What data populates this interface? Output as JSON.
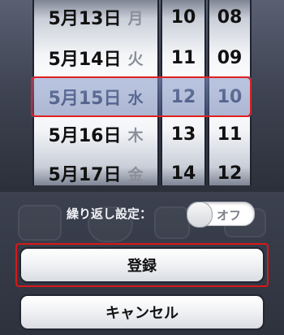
{
  "picker": {
    "dates": [
      {
        "date": "5月13日",
        "weekday": "月"
      },
      {
        "date": "5月14日",
        "weekday": "火"
      },
      {
        "date": "5月15日",
        "weekday": "水"
      },
      {
        "date": "5月16日",
        "weekday": "木"
      },
      {
        "date": "5月17日",
        "weekday": "金"
      }
    ],
    "hours": [
      "10",
      "11",
      "12",
      "13",
      "14"
    ],
    "minutes": [
      "08",
      "09",
      "10",
      "11",
      "12"
    ],
    "selected": {
      "date": "5月15日",
      "weekday": "水",
      "hour": "12",
      "minute": "10"
    }
  },
  "repeat": {
    "label": "繰り返し設定：",
    "toggle_label": "オフ",
    "enabled": false
  },
  "buttons": {
    "register": "登録",
    "cancel": "キャンセル"
  }
}
